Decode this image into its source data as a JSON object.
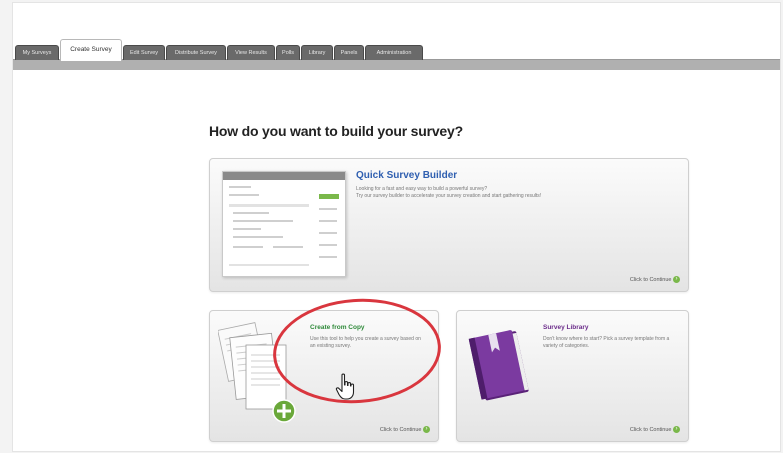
{
  "tabs": [
    {
      "label": "My Surveys",
      "active": false
    },
    {
      "label": "Create Survey",
      "active": true
    },
    {
      "label": "Edit Survey",
      "active": false
    },
    {
      "label": "Distribute Survey",
      "active": false
    },
    {
      "label": "View Results",
      "active": false
    },
    {
      "label": "Polls",
      "active": false
    },
    {
      "label": "Library",
      "active": false
    },
    {
      "label": "Panels",
      "active": false
    },
    {
      "label": "Administration",
      "active": false
    }
  ],
  "main": {
    "heading": "How do you want to build your survey?"
  },
  "options": {
    "quick_builder": {
      "title": "Quick Survey Builder",
      "description_line1": "Looking for a fast and easy way to build a powerful survey?",
      "description_line2": "Try our survey builder to accelerate your survey creation and start gathering results!",
      "continue_label": "Click to Continue"
    },
    "create_from_copy": {
      "title": "Create from Copy",
      "description": "Use this tool to help you create a survey based on an existing survey.",
      "continue_label": "Click to Continue"
    },
    "survey_library": {
      "title": "Survey Library",
      "description": "Don't know where to start? Pick a survey template from a variety of categories.",
      "continue_label": "Click to Continue"
    }
  },
  "colors": {
    "link_blue": "#2f5fb0",
    "library_purple": "#6b2c8a",
    "highlight_red": "#d9363e",
    "go_green": "#7ab84a"
  }
}
